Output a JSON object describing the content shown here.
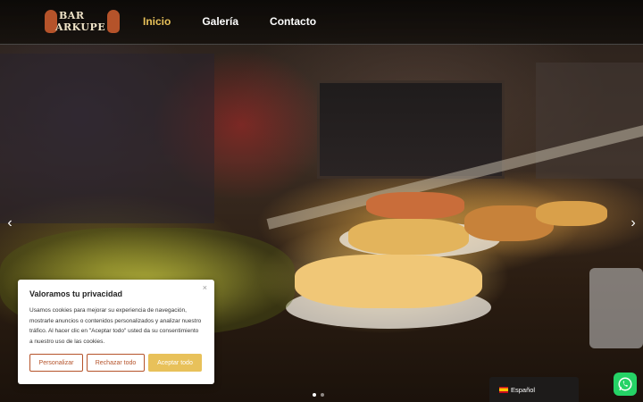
{
  "brand": {
    "logo_line1": "BAR",
    "logo_line2": "ARKUPE",
    "accent_color": "#e8c15a",
    "brand_color": "#b5532a"
  },
  "nav": {
    "items": [
      {
        "label": "Inicio",
        "active": true
      },
      {
        "label": "Galería",
        "active": false
      },
      {
        "label": "Contacto",
        "active": false
      }
    ]
  },
  "carousel": {
    "prev_icon": "chevron-left-icon",
    "next_icon": "chevron-right-icon",
    "prev_glyph": "‹",
    "next_glyph": "›",
    "slide_count": 2,
    "active_slide": 1
  },
  "cookie_banner": {
    "title": "Valoramos tu privacidad",
    "close_glyph": "×",
    "body": "Usamos cookies para mejorar su experiencia de navegación, mostrarle anuncios o contenidos personalizados y analizar nuestro tráfico. Al hacer clic en \"Aceptar todo\" usted da su consentimiento a nuestro uso de las cookies.",
    "customize_label": "Personalizar",
    "reject_label": "Rechazar todo",
    "accept_label": "Aceptar todo"
  },
  "language": {
    "label": "Español",
    "flag_icon": "spain-flag-icon"
  },
  "whatsapp": {
    "icon": "whatsapp-icon",
    "color": "#25d366"
  }
}
